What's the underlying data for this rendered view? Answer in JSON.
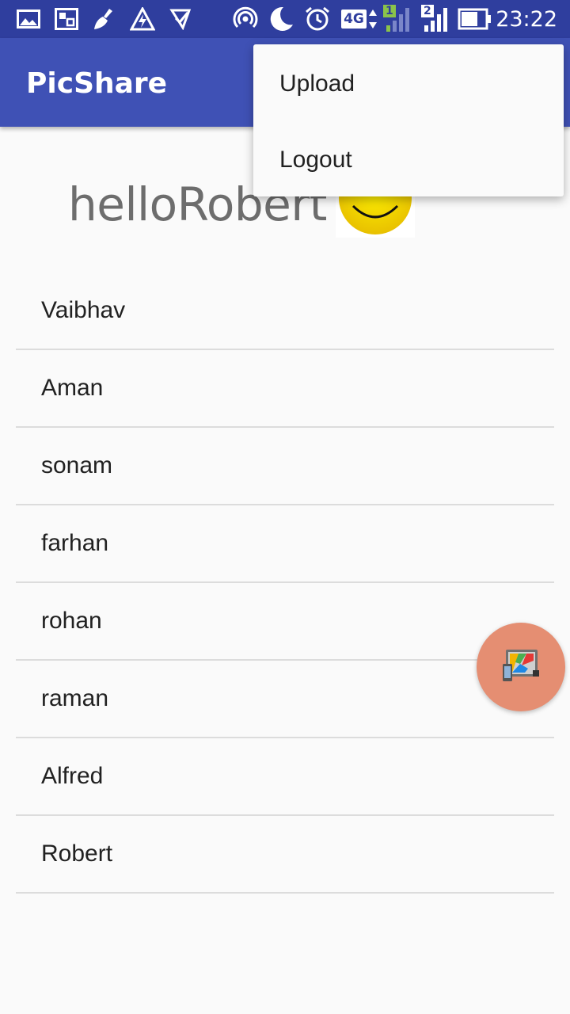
{
  "status_bar": {
    "time": "23:22",
    "network_label": "4G",
    "sim1_label": "1",
    "sim2_label": "2",
    "icons": [
      "gallery-icon",
      "screen-icon",
      "cleaner-icon",
      "boost-icon",
      "checkmark-icon",
      "hotspot-icon",
      "moon-icon",
      "alarm-icon",
      "network-4g-icon",
      "signal-sim1-icon",
      "signal-sim2-icon",
      "battery-icon"
    ]
  },
  "toolbar": {
    "title": "PicShare"
  },
  "menu": {
    "items": [
      {
        "label": "Upload"
      },
      {
        "label": "Logout"
      }
    ]
  },
  "greeting": {
    "text": "helloRobert",
    "icon": "smiley-icon"
  },
  "users": [
    {
      "name": "Vaibhav"
    },
    {
      "name": "Aman"
    },
    {
      "name": "sonam"
    },
    {
      "name": "farhan"
    },
    {
      "name": "rohan"
    },
    {
      "name": "raman"
    },
    {
      "name": "Alfred"
    },
    {
      "name": "Robert"
    }
  ],
  "fab": {
    "icon": "gallery-app-icon"
  },
  "colors": {
    "primary": "#3f51b5",
    "primary_dark": "#2f3e9e",
    "fab": "#e58e72",
    "background": "#fafafa"
  }
}
